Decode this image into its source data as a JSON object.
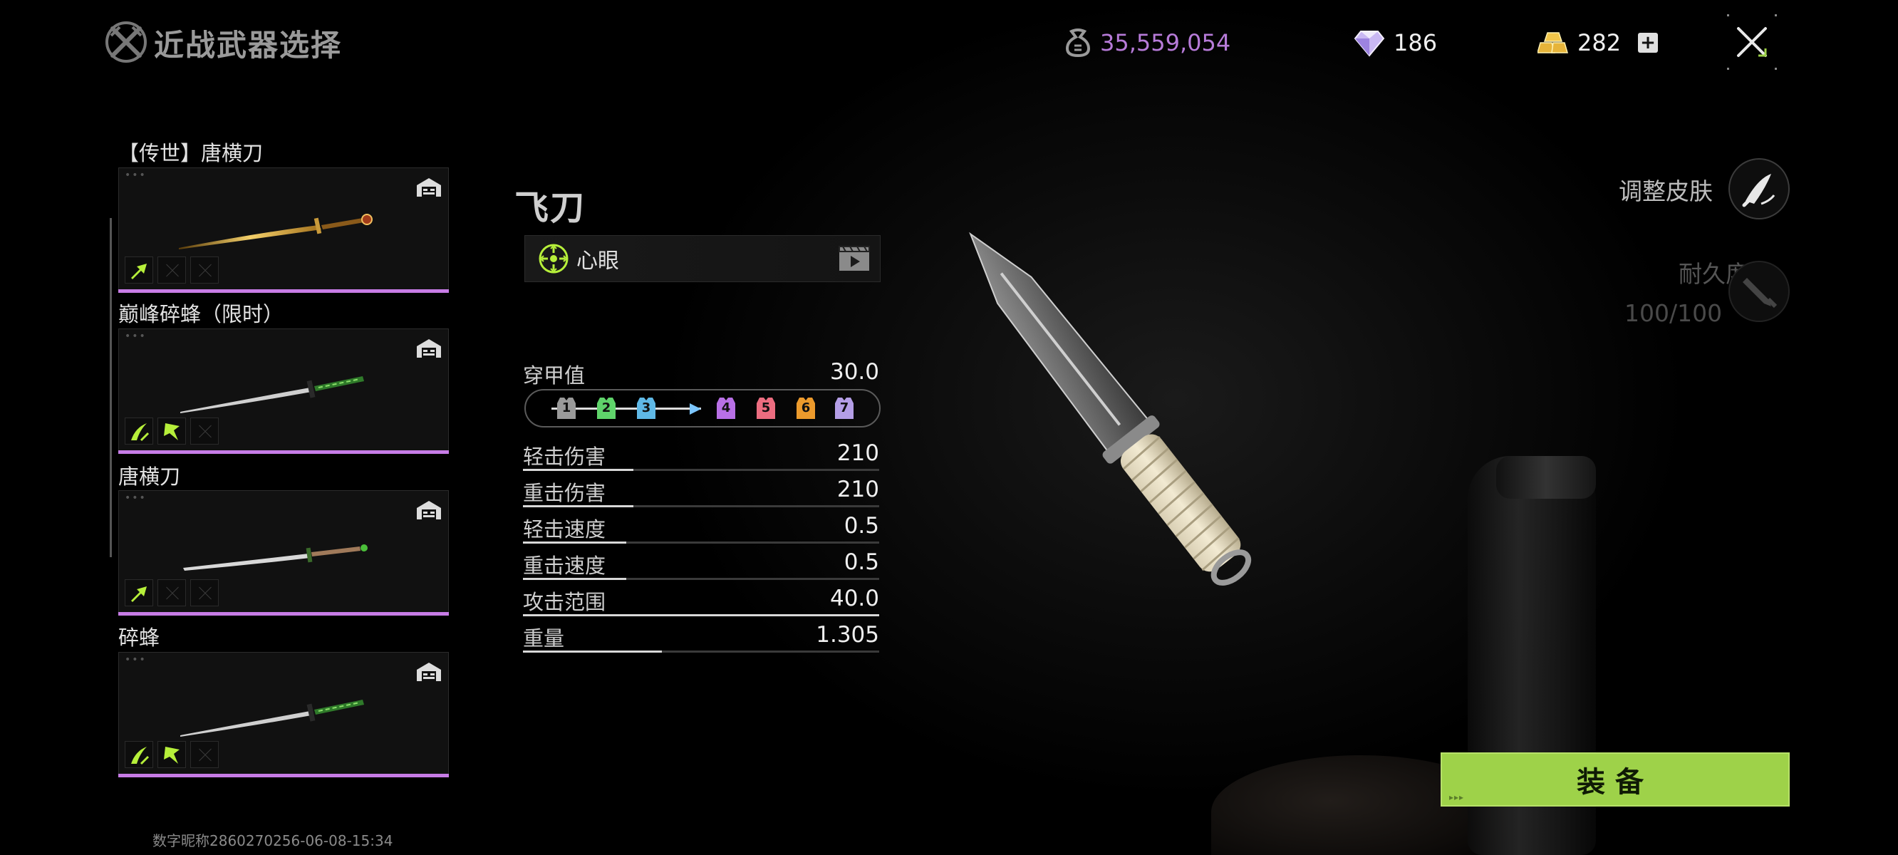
{
  "header": {
    "title": "近战武器选择",
    "currency_money": "35,559,054",
    "currency_diamond": "186",
    "currency_gold": "282"
  },
  "weapons": [
    {
      "label": "【传世】唐横刀",
      "blade": "gold"
    },
    {
      "label": "巅峰碎蜂（限时）",
      "blade": "green"
    },
    {
      "label": "唐横刀",
      "blade": "silver"
    },
    {
      "label": "碎蜂",
      "blade": "green"
    }
  ],
  "selected": {
    "name": "飞刀",
    "skill": "心眼"
  },
  "armor": {
    "label": "穿甲值",
    "value": "30.0",
    "levels": [
      "1",
      "2",
      "3",
      "4",
      "5",
      "6",
      "7"
    ]
  },
  "stats": [
    {
      "label": "轻击伤害",
      "value": "210",
      "fill": 0.31
    },
    {
      "label": "重击伤害",
      "value": "210",
      "fill": 0.31
    },
    {
      "label": "轻击速度",
      "value": "0.5",
      "fill": 0.29
    },
    {
      "label": "重击速度",
      "value": "0.5",
      "fill": 0.29
    },
    {
      "label": "攻击范围",
      "value": "40.0",
      "fill": 1.0
    },
    {
      "label": "重量",
      "value": "1.305",
      "fill": 0.39
    }
  ],
  "right": {
    "skin_label": "调整皮肤",
    "durability_label": "耐久度",
    "durability_value": "100/100"
  },
  "equip_label": "装备",
  "footer": "数字昵称2860270256-06-08-15:34",
  "colors": {
    "rarity_purple": "#c77ce6",
    "equip_green": "#9ed249",
    "money_purple": "#b77bd9"
  }
}
